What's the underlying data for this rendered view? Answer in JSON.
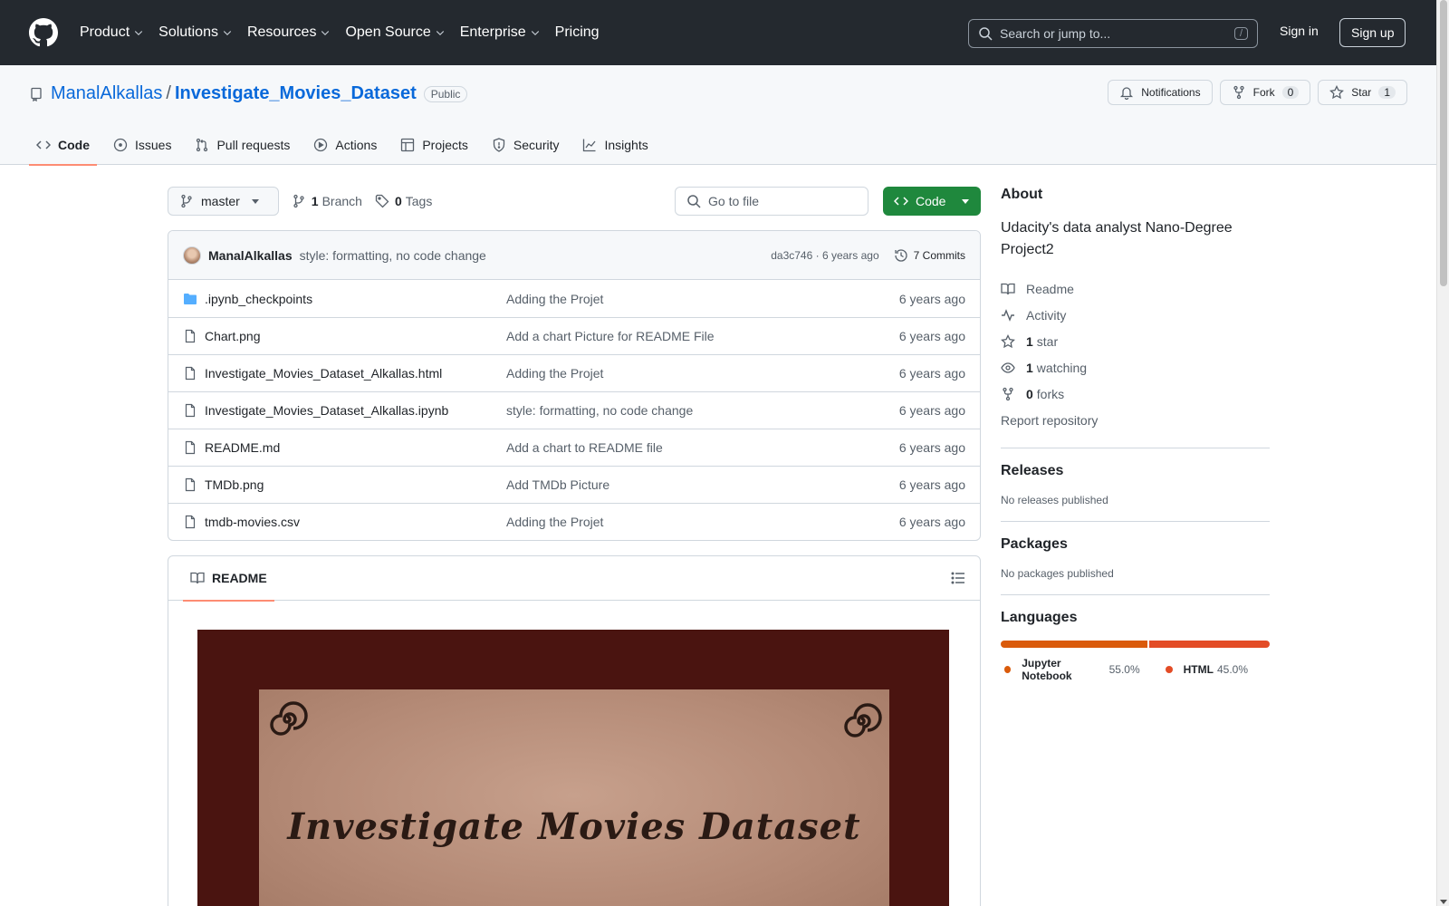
{
  "header": {
    "nav": [
      "Product",
      "Solutions",
      "Resources",
      "Open Source",
      "Enterprise",
      "Pricing"
    ],
    "search_placeholder": "Search or jump to...",
    "search_kbd": "/",
    "signin": "Sign in",
    "signup": "Sign up"
  },
  "repo": {
    "owner": "ManalAlkallas",
    "separator": "/",
    "name": "Investigate_Movies_Dataset",
    "visibility": "Public",
    "notifications": "Notifications",
    "fork_label": "Fork",
    "fork_count": "0",
    "star_label": "Star",
    "star_count": "1"
  },
  "tabs": [
    {
      "label": "Code",
      "icon": "code-icon",
      "active": true
    },
    {
      "label": "Issues",
      "icon": "issue-icon"
    },
    {
      "label": "Pull requests",
      "icon": "pull-request-icon"
    },
    {
      "label": "Actions",
      "icon": "play-icon"
    },
    {
      "label": "Projects",
      "icon": "table-icon"
    },
    {
      "label": "Security",
      "icon": "shield-icon"
    },
    {
      "label": "Insights",
      "icon": "graph-icon"
    }
  ],
  "toolbar": {
    "branch": "master",
    "branch_count": "1",
    "branch_label": "Branch",
    "tag_count": "0",
    "tag_label": "Tags",
    "goto_placeholder": "Go to file",
    "code_button": "Code"
  },
  "commit": {
    "author": "ManalAlkallas",
    "message": "style: formatting, no code change",
    "hash_time": "da3c746 · 6 years ago",
    "commits": "7 Commits"
  },
  "files": [
    {
      "name": ".ipynb_checkpoints",
      "type": "folder",
      "message": "Adding the Projet",
      "date": "6 years ago"
    },
    {
      "name": "Chart.png",
      "type": "file",
      "message": "Add a chart Picture for README File",
      "date": "6 years ago"
    },
    {
      "name": "Investigate_Movies_Dataset_Alkallas.html",
      "type": "file",
      "message": "Adding the Projet",
      "date": "6 years ago"
    },
    {
      "name": "Investigate_Movies_Dataset_Alkallas.ipynb",
      "type": "file",
      "message": "style: formatting, no code change",
      "date": "6 years ago"
    },
    {
      "name": "README.md",
      "type": "file",
      "message": "Add a chart to README file",
      "date": "6 years ago"
    },
    {
      "name": "TMDb.png",
      "type": "file",
      "message": "Add TMDb Picture",
      "date": "6 years ago"
    },
    {
      "name": "tmdb-movies.csv",
      "type": "file",
      "message": "Adding the Projet",
      "date": "6 years ago"
    }
  ],
  "readme": {
    "tab": "README",
    "banner_title": "Investigate Movies Dataset"
  },
  "sidebar": {
    "about_title": "About",
    "description": "Udacity's data analyst Nano-Degree Project2",
    "readme": "Readme",
    "activity": "Activity",
    "stars_count": "1",
    "stars_label": "star",
    "watching_count": "1",
    "watching_label": "watching",
    "forks_count": "0",
    "forks_label": "forks",
    "report": "Report repository",
    "releases_title": "Releases",
    "releases_text": "No releases published",
    "packages_title": "Packages",
    "packages_text": "No packages published",
    "languages_title": "Languages",
    "languages": [
      {
        "name": "Jupyter Notebook",
        "percent": "55.0%",
        "value": 55.0,
        "color": "#DA5B0B"
      },
      {
        "name": "HTML",
        "percent": "45.0%",
        "value": 45.0,
        "color": "#e34c26"
      }
    ]
  }
}
